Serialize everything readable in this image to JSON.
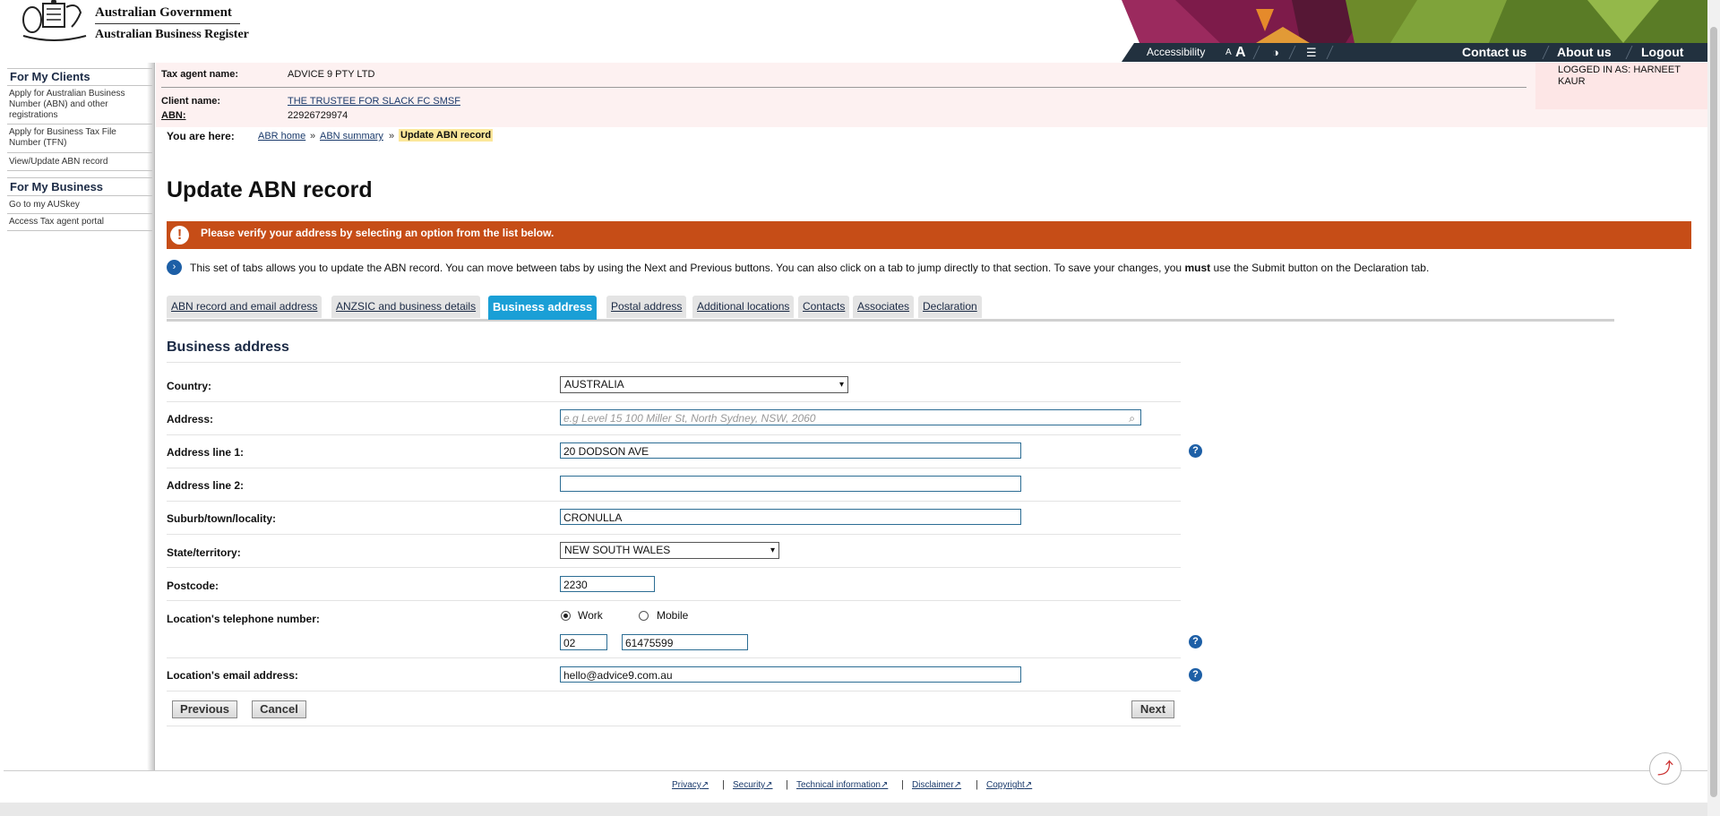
{
  "header": {
    "gov_title": "Australian Government",
    "register_title": "Australian Business Register",
    "topbar": {
      "accessibility": "Accessibility",
      "font_small": "A",
      "font_large": "A",
      "contact_us": "Contact us",
      "about_us": "About us",
      "logout": "Logout"
    },
    "logged_in": "LOGGED IN AS: HARNEET KAUR"
  },
  "sidebar": {
    "clients_heading": "For My Clients",
    "clients_links": [
      "Apply for Australian Business Number (ABN) and other registrations",
      "Apply for Business Tax File Number (TFN)",
      "View/Update ABN record"
    ],
    "business_heading": "For My Business",
    "business_links": [
      "Go to my AUSkey",
      "Access Tax agent portal"
    ]
  },
  "agent": {
    "tax_agent_label": "Tax agent name:",
    "tax_agent_value": "ADVICE 9 PTY LTD",
    "client_label": "Client name:",
    "client_value": "THE TRUSTEE FOR SLACK FC SMSF",
    "abn_label": "ABN:",
    "abn_value": "22926729974"
  },
  "breadcrumb": {
    "label": "You are here:",
    "items": [
      "ABR home",
      "ABN summary"
    ],
    "separator": "»",
    "current": "Update ABN record"
  },
  "page_title": "Update ABN record",
  "alert": "Please verify your address by selecting an option from the list below.",
  "info": {
    "text_before": "This set of tabs allows you to update the ABN record. You can move between tabs by using the Next and Previous buttons. You can also click on a tab to jump directly to that section. To save your changes, you ",
    "text_bold": "must",
    "text_after": " use the Submit button on the Declaration tab."
  },
  "tabs": [
    "ABN record and email address",
    "ANZSIC and business details",
    "Business address",
    "Postal address",
    "Additional locations",
    "Contacts",
    "Associates",
    "Declaration"
  ],
  "active_tab": "Business address",
  "section_title": "Business address",
  "form": {
    "country_label": "Country:",
    "country_value": "AUSTRALIA",
    "address_label": "Address:",
    "address_placeholder": "e.g Level 15 100 Miller St, North Sydney, NSW, 2060",
    "line1_label": "Address line 1:",
    "line1_value": "20 DODSON AVE",
    "line2_label": "Address line 2:",
    "line2_value": "",
    "suburb_label": "Suburb/town/locality:",
    "suburb_value": "CRONULLA",
    "state_label": "State/territory:",
    "state_value": "NEW SOUTH WALES",
    "postcode_label": "Postcode:",
    "postcode_value": "2230",
    "phone_label": "Location's telephone number:",
    "phone_type_work": "Work",
    "phone_type_mobile": "Mobile",
    "phone_type_selected": "Work",
    "area_code": "02",
    "phone_number": "61475599",
    "email_label": "Location's email address:",
    "email_value": "hello@advice9.com.au"
  },
  "buttons": {
    "previous": "Previous",
    "cancel": "Cancel",
    "next": "Next"
  },
  "footer": [
    "Privacy",
    "Security",
    "Technical information",
    "Disclaimer",
    "Copyright"
  ],
  "colors": {
    "alert_bg": "#c64d17",
    "active_tab_bg": "#1a9fd6",
    "help_icon": "#1d5fa6",
    "agent_panel_bg": "#fdf1f1",
    "breadcrumb_highlight": "#fbe79a"
  }
}
